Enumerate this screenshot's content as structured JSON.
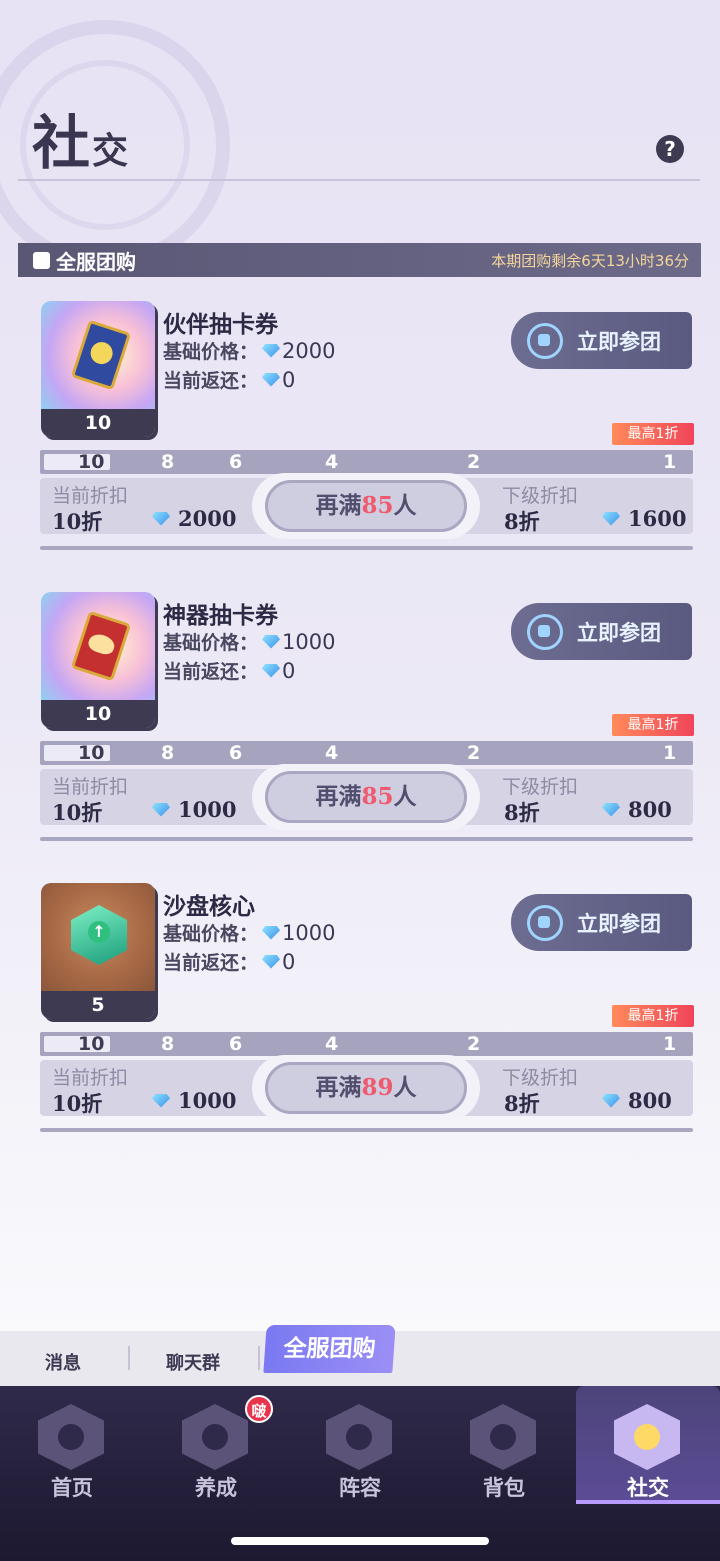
{
  "header": {
    "title_big": "社",
    "title_small": "交",
    "help_icon": "?"
  },
  "section": {
    "title": "全服团购",
    "timer": "本期团购剩余6天13小时36分"
  },
  "labels": {
    "base_price": "基础价格：",
    "current_rebate": "当前返还：",
    "join": "立即参团",
    "max_tag": "最高1折",
    "current_discount": "当前折扣",
    "next_discount": "下级折扣",
    "remain_prefix": "再满",
    "remain_suffix": "人"
  },
  "progress_ticks": [
    "10",
    "8",
    "6",
    "4",
    "2",
    "1"
  ],
  "items": [
    {
      "name": "伙伴抽卡券",
      "icon": "partner-card-ticket-icon",
      "count": "10",
      "base_price": "2000",
      "rebate": "0",
      "current_discount": "10折",
      "current_price": "2000",
      "next_discount": "8折",
      "next_price": "1600",
      "remaining": "85",
      "progress": 0.1
    },
    {
      "name": "神器抽卡券",
      "icon": "artifact-card-ticket-icon",
      "count": "10",
      "base_price": "1000",
      "rebate": "0",
      "current_discount": "10折",
      "current_price": "1000",
      "next_discount": "8折",
      "next_price": "800",
      "remaining": "85",
      "progress": 0.1
    },
    {
      "name": "沙盘核心",
      "icon": "sandbox-core-icon",
      "count": "5",
      "base_price": "1000",
      "rebate": "0",
      "current_discount": "10折",
      "current_price": "1000",
      "next_discount": "8折",
      "next_price": "800",
      "remaining": "89",
      "progress": 0.1
    }
  ],
  "sub_tabs": {
    "messages": "消息",
    "chat_group": "聊天群",
    "group_buy": "全服团购"
  },
  "nav": {
    "home": "首页",
    "develop": "养成",
    "lineup": "阵容",
    "bag": "背包",
    "social": "社交",
    "develop_badge": "啵"
  }
}
